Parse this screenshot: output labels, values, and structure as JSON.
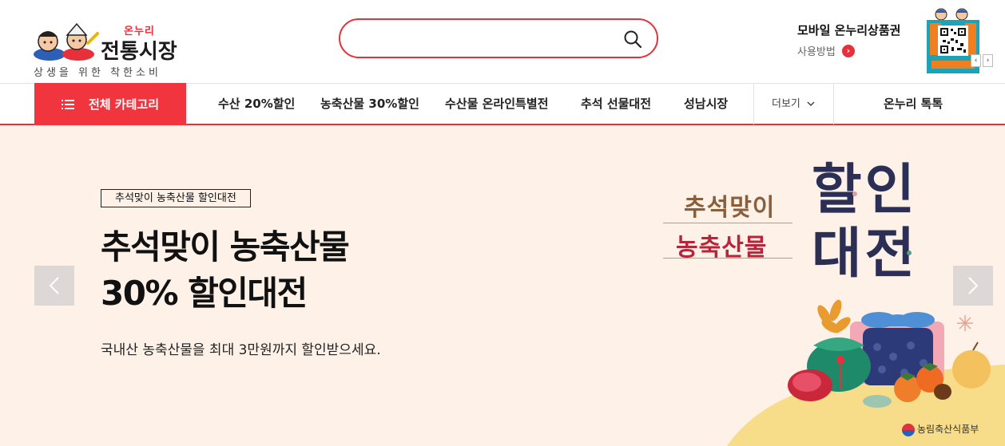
{
  "header": {
    "logo": {
      "small_text": "온누리",
      "title": "전통시장",
      "slogan": "상생을 위한 착한소비"
    },
    "search": {
      "value": "",
      "placeholder": ""
    },
    "mobile": {
      "title": "모바일 온누리상품권",
      "usage_label": "사용방법"
    },
    "qr_prev": "‹",
    "qr_next": "›"
  },
  "nav": {
    "all_category": "전체 카테고리",
    "items": [
      {
        "label": "수산 20%할인"
      },
      {
        "label": "농축산물 30%할인"
      },
      {
        "label": "수산물 온라인특별전"
      },
      {
        "label": "추석 선물대전"
      },
      {
        "label": "성남시장"
      }
    ],
    "more": "더보기",
    "talk": "온누리 톡톡"
  },
  "banner": {
    "badge": "추석맞이 농축산물 할인대전",
    "headline_line1": "추석맞이 농축산물",
    "headline_line2": "30% 할인대전",
    "subline": "국내산 농축산물을 최대 3만원까지 할인받으세요.",
    "art_line1": "추석맞이",
    "art_line2": "농축산물",
    "art_big_line1": "할인",
    "art_big_line2": "대전",
    "ministry": "농림축산식품부"
  },
  "colors": {
    "accent": "#e8303a",
    "banner_bg": "#fdf1e8",
    "art_navy": "#2b2f55"
  }
}
